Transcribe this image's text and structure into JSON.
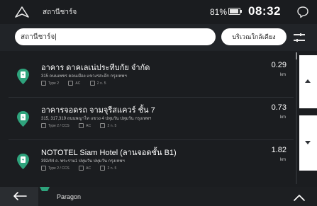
{
  "status_bar": {
    "title": "สถานีชาร์จ",
    "battery": "81%",
    "time": "08:32"
  },
  "search": {
    "value": "สถานีชาร์จ|",
    "nearby_button": "บริเวณใกล้เคียง"
  },
  "results": [
    {
      "name": "อาคาร ดาคเลเน่ประทีบกัย จำกัด",
      "address": "315 ถนนเพชร ดอนเมือง แขวงรสะอึก กรุงเทพฯ",
      "connector": "Type 2",
      "current": "AC",
      "power": "2 ก. 5",
      "distance": "0.29",
      "unit": "km"
    },
    {
      "name": "อาคารจอดรถ จามจุรีสแควร์ ชั้น 7",
      "address": "315, 317,319 ถนนพญาไท แขวง 4 ปทุมวัน ปทุมวัน กรุงเทพฯ",
      "connector": "Type 2 / CCS",
      "current": "AC",
      "power": "2 ก. 5",
      "distance": "0.73",
      "unit": "km"
    },
    {
      "name": "NOTOTEL Siam Hotel (ลานจอดชั้น B1)",
      "address": "392/44 ถ. พระราม1 ปทุมวัน ปทุมวัน กรุงเทพฯ",
      "connector": "Type 2 / CCS",
      "current": "AC",
      "power": "2 ก. 5",
      "distance": "1.82",
      "unit": "km"
    }
  ],
  "bottom_bar": {
    "next_item": "Paragon"
  },
  "colors": {
    "background": "#1b1d20",
    "pin_green": "#2ea37c",
    "panel_white": "#ffffff"
  },
  "icons": {
    "nav": "navigation-arrow-icon",
    "battery": "battery-icon",
    "message": "message-bubble-icon",
    "filter": "filter-sliders-icon",
    "pin": "charging-station-pin-icon",
    "back": "back-arrow-icon",
    "up": "chevron-up-icon"
  }
}
